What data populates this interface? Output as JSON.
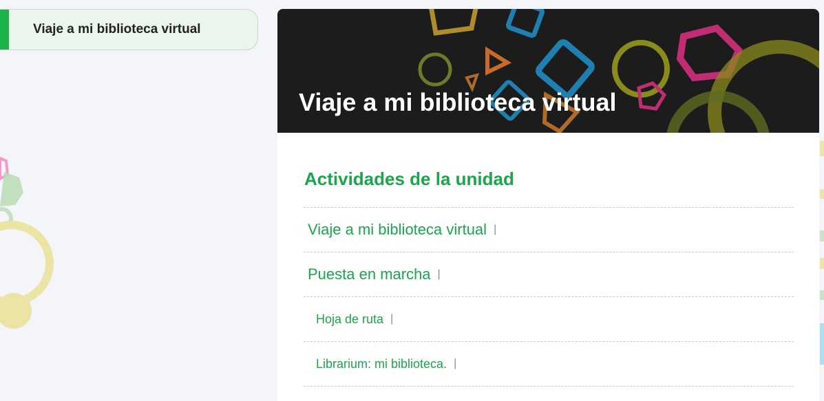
{
  "sidebar": {
    "current_item": "Viaje a mi biblioteca virtual",
    "accent_color": "#1db34a"
  },
  "banner": {
    "title": "Viaje a mi biblioteca virtual",
    "background_color": "#1c1c1c"
  },
  "main": {
    "section_heading": "Actividades de la unidad",
    "activities": [
      {
        "label": "Viaje a mi biblioteca virtual",
        "separator": "|"
      },
      {
        "label": "Puesta en marcha",
        "separator": "|"
      },
      {
        "label": "Hoja de ruta",
        "separator": "|"
      },
      {
        "label": "Librarium: mi biblioteca.",
        "separator": "|"
      }
    ]
  },
  "colors": {
    "link_green": "#1aa64b",
    "page_bg": "#f3f5f9"
  }
}
